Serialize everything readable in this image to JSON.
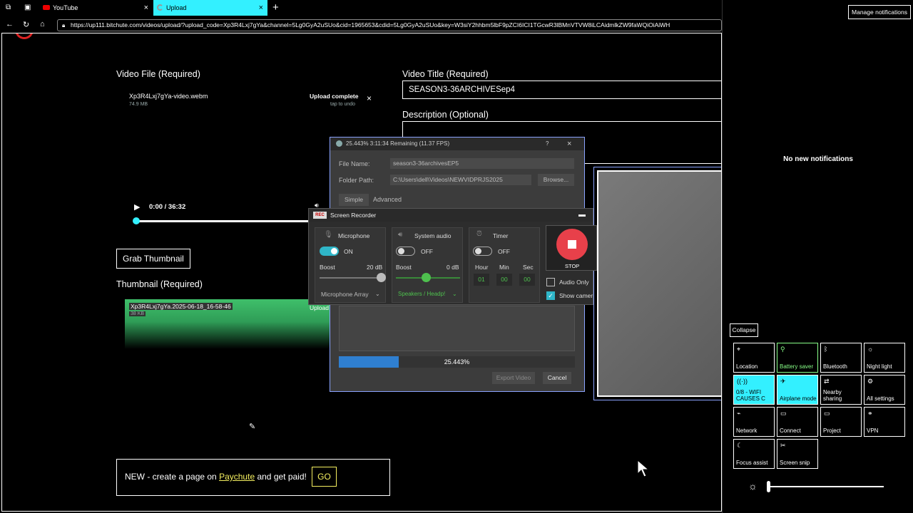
{
  "browser": {
    "tabs": [
      {
        "label": "YouTube"
      },
      {
        "label": "Upload"
      }
    ],
    "url": "https://up111.bitchute.com/videos/upload/?upload_code=Xp3R4Lxj7gYa&channel=5Lg0GyA2uSUo&cid=1965653&cdid=5Lg0GyA2uSUo&key=W3siY2hhbm5lbF9pZCI6ICI1TGcwR3lBMnVTVW8iLCAidmlkZW9faWQiOiAiWH"
  },
  "upload": {
    "video_file_label": "Video File (Required)",
    "file_name": "Xp3R4Lxj7gYa-video.webm",
    "file_size": "74.9 MB",
    "upload_status": "Upload complete",
    "upload_hint": "tap to undo",
    "player_time": "0:00 / 36:32",
    "grab_thumbnail": "Grab Thumbnail",
    "thumbnail_label": "Thumbnail (Required)",
    "thumb_file": "Xp3R4Lxj7gYa.2025-06-18_16-58-46",
    "thumb_size": "38 KB",
    "thumb_status": "Upload",
    "video_title_label": "Video Title (Required)",
    "video_title_value": "SEASON3-36ARCHIVESep4",
    "description_label": "Description (Optional)",
    "promo_prefix": "NEW - create a page on ",
    "promo_link": "Paychute",
    "promo_suffix": " and get paid!",
    "go": "GO"
  },
  "export_dialog": {
    "title": "25.443%  3:11:34 Remaining (11.37 FPS)",
    "help": "?",
    "close": "×",
    "file_name_label": "File Name:",
    "file_name_value": "season3-36archivesEP5",
    "folder_label": "Folder Path:",
    "folder_value": "C:\\Users\\dell\\Videos\\NEWVIDPRJS2025",
    "browse": "Browse...",
    "tab_simple": "Simple",
    "tab_advanced": "Advanced",
    "progress_text": "25.443%",
    "progress": 0.25443,
    "export_video": "Export Video",
    "cancel": "Cancel"
  },
  "screen_recorder": {
    "title": "Screen Recorder",
    "mic": {
      "label": "Microphone",
      "state": "ON",
      "boost_label": "Boost",
      "boost_value": "20 dB",
      "device": "Microphone Array",
      "boost_level": 1.0
    },
    "sys": {
      "label": "System audio",
      "state": "OFF",
      "boost_label": "Boost",
      "boost_value": "0 dB",
      "device": "Speakers / Headp!",
      "boost_level": 0.5
    },
    "timer": {
      "label": "Timer",
      "state": "OFF",
      "hour_label": "Hour",
      "min_label": "Min",
      "sec_label": "Sec",
      "hour": "01",
      "min": "00",
      "sec": "00"
    },
    "stop": "STOP",
    "audio_only": "Audio Only",
    "show_camera": "Show camera"
  },
  "notifications": {
    "manage": "Manage notifications",
    "empty": "No new notifications",
    "collapse": "Collapse",
    "tiles": [
      {
        "label": "Location",
        "icon": "location-icon"
      },
      {
        "label": "Battery saver",
        "icon": "battery-saver-icon"
      },
      {
        "label": "Bluetooth",
        "icon": "bluetooth-icon"
      },
      {
        "label": "Night light",
        "icon": "night-light-icon"
      },
      {
        "label": "0/8 - WIFI CAUSES C",
        "icon": "wifi-icon"
      },
      {
        "label": "Airplane mode",
        "icon": "airplane-icon"
      },
      {
        "label": "Nearby sharing",
        "icon": "nearby-sharing-icon"
      },
      {
        "label": "All settings",
        "icon": "settings-icon"
      },
      {
        "label": "Network",
        "icon": "network-icon"
      },
      {
        "label": "Connect",
        "icon": "connect-icon"
      },
      {
        "label": "Project",
        "icon": "project-icon"
      },
      {
        "label": "VPN",
        "icon": "vpn-icon"
      },
      {
        "label": "Focus assist",
        "icon": "focus-assist-icon"
      },
      {
        "label": "Screen snip",
        "icon": "screen-snip-icon"
      }
    ],
    "brightness": 0.0
  },
  "colors": {
    "accent_cyan": "#33f0ff",
    "record_red": "#e8404a",
    "toggle_on": "#2fb6c8",
    "progress_blue": "#2f7fd0"
  }
}
